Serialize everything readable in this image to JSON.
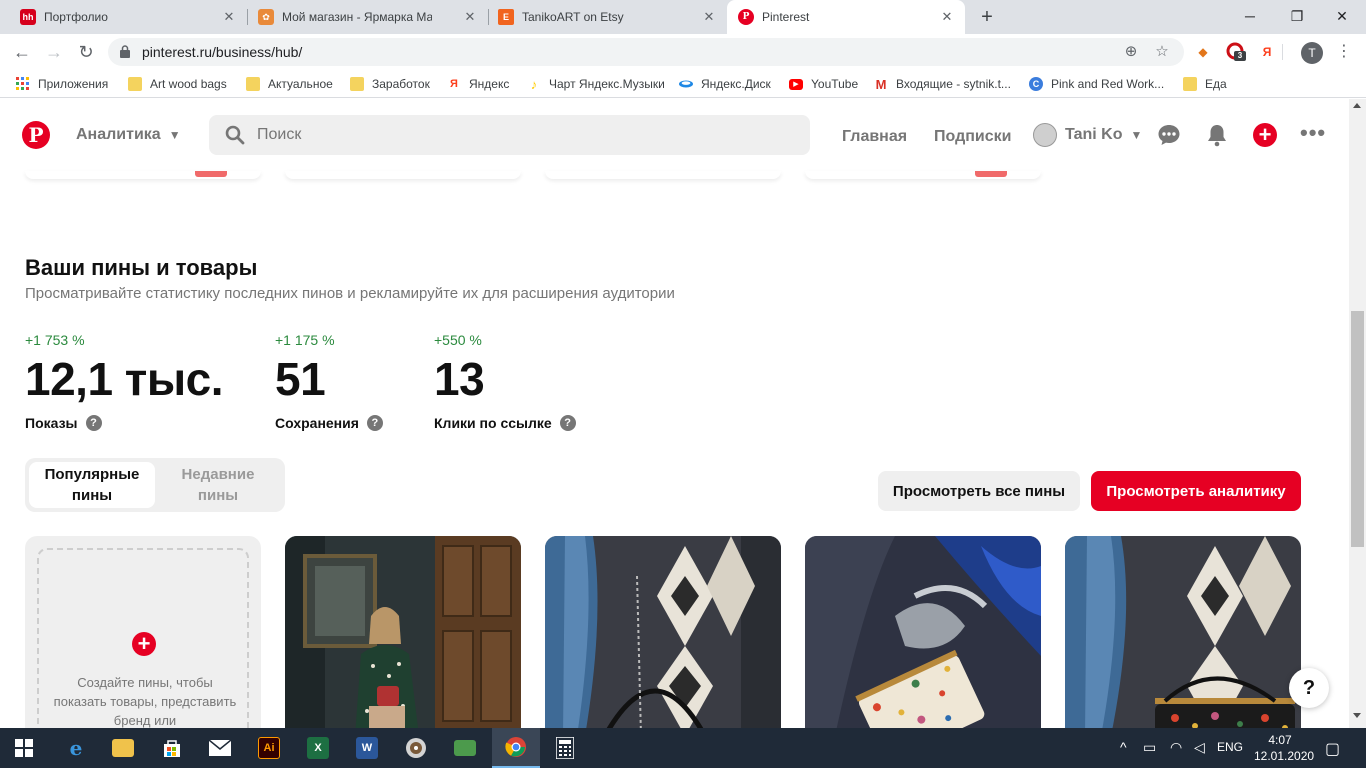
{
  "browser": {
    "tabs": [
      {
        "title": "Портфолио",
        "favicon_text": "hh",
        "favicon_color": "#d6001c"
      },
      {
        "title": "Мой магазин - Ярмарка Мастеров",
        "favicon_text": "✿",
        "favicon_color": "#e98a3a"
      },
      {
        "title": "TanikoART on Etsy",
        "favicon_text": "E",
        "favicon_color": "#f1641e"
      },
      {
        "title": "Pinterest",
        "favicon_text": "P",
        "favicon_color": "#e60023"
      }
    ],
    "url": "pinterest.ru/business/hub/",
    "profile_letter": "T",
    "ext_badge": "3",
    "ext_yandex": "Я",
    "bookmarks": [
      {
        "label": "Приложения",
        "icon": "apps-grid-icon"
      },
      {
        "label": "Art wood bags",
        "icon": "folder-icon"
      },
      {
        "label": "Актуальное",
        "icon": "folder-icon"
      },
      {
        "label": "Заработок",
        "icon": "folder-icon"
      },
      {
        "label": "Яндекс",
        "icon": "yandex-icon"
      },
      {
        "label": "Чарт Яндекс.Музыки",
        "icon": "music-icon"
      },
      {
        "label": "Яндекс.Диск",
        "icon": "disk-icon"
      },
      {
        "label": "YouTube",
        "icon": "youtube-icon"
      },
      {
        "label": "Входящие - sytnik.t...",
        "icon": "gmail-icon"
      },
      {
        "label": "Pink and Red Work...",
        "icon": "canva-icon"
      },
      {
        "label": "Еда",
        "icon": "folder-icon"
      }
    ]
  },
  "header": {
    "analytics_label": "Аналитика",
    "search_placeholder": "Поиск",
    "home_label": "Главная",
    "following_label": "Подписки",
    "user_name": "Tani Ko"
  },
  "section": {
    "title": "Ваши пины и товары",
    "subtitle": "Просматривайте статистику последних пинов и рекламируйте их для расширения аудитории",
    "stats": [
      {
        "change": "+1 753 %",
        "value": "12,1 тыс.",
        "label": "Показы"
      },
      {
        "change": "+1 175 %",
        "value": "51",
        "label": "Сохранения"
      },
      {
        "change": "+550 %",
        "value": "13",
        "label": "Клики по ссылке"
      }
    ],
    "toggle": {
      "popular_line1": "Популярные",
      "popular_line2": "пины",
      "recent_line1": "Недавние",
      "recent_line2": "пины"
    },
    "view_all_label": "Просмотреть все пины",
    "view_analytics_label": "Просмотреть аналитику",
    "create_text": "Создайте пины, чтобы показать товары, представить бренд или"
  },
  "help_label": "?",
  "taskbar": {
    "lang": "ENG",
    "time": "4:07",
    "date": "12.01.2020"
  },
  "colors": {
    "brand_red": "#e60023",
    "positive_green": "#2b8a3e",
    "muted_gray": "#767676"
  }
}
